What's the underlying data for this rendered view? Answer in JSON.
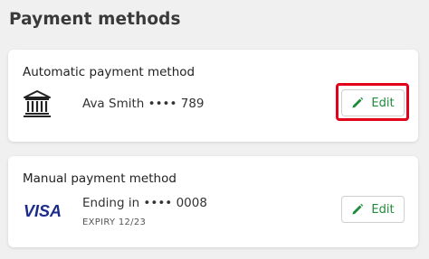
{
  "page": {
    "title": "Payment methods"
  },
  "automatic": {
    "title": "Automatic payment method",
    "icon": "bank-icon",
    "name_masked": "Ava Smith •••• 789",
    "edit_label": "Edit"
  },
  "manual": {
    "title": "Manual payment method",
    "icon": "visa-logo",
    "logo_text": "VISA",
    "ending": "Ending in •••• 0008",
    "expiry": "EXPIRY 12/23",
    "edit_label": "Edit"
  },
  "colors": {
    "accent_green": "#1e8b3a",
    "highlight_red": "#e3001b",
    "visa_blue": "#1a2b8c",
    "background": "#f0f0f0"
  }
}
